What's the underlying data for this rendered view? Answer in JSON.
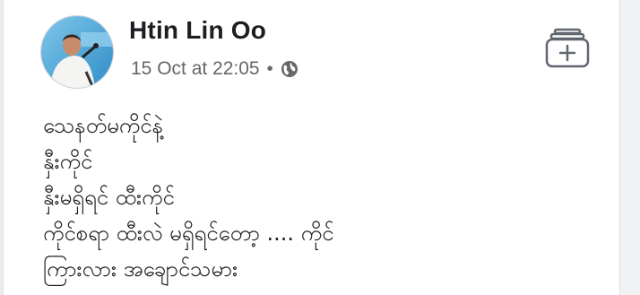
{
  "post": {
    "author": "Htin Lin Oo",
    "timestamp": "15 Oct at 22:05",
    "separator": "•",
    "privacy_icon": "globe-icon",
    "save_icon": "add-to-collection-icon",
    "lines": [
      "သေနတ်မကိုင်နဲ့",
      "နှီးကိုင်",
      "နှီးမရှိရင် ထီးကိုင်",
      "ကိုင်စရာ ထီးလဲ မရှိရင်တော့ .... ကိုင်",
      "ကြားလား အချောင်သမား"
    ]
  },
  "colors": {
    "name": "#1c1e21",
    "meta": "#65676b",
    "background": "#e9ebee"
  }
}
